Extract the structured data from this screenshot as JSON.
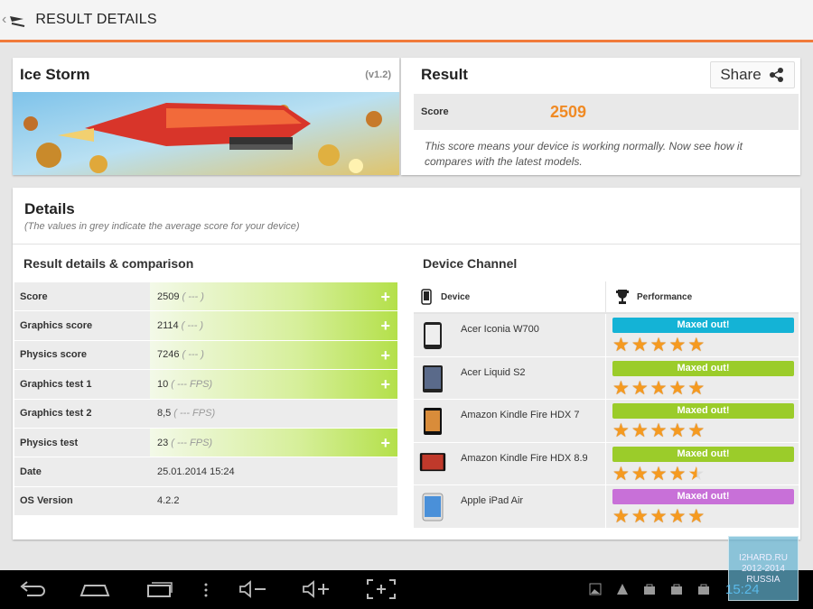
{
  "actionbar": {
    "title": "RESULT DETAILS"
  },
  "test": {
    "name": "Ice Storm",
    "version": "(v1.2)"
  },
  "result": {
    "title": "Result",
    "share_label": "Share",
    "score_label": "Score",
    "score_value": "2509",
    "note": "This score means your device is working normally. Now see how it compares with the latest models."
  },
  "details": {
    "title": "Details",
    "subtitle": "(The values in grey indicate the average score for your device)",
    "left_title": "Result details & comparison",
    "right_title": "Device Channel",
    "rows": [
      {
        "label": "Score",
        "value": "2509",
        "avg": "( --- )",
        "expandable": true
      },
      {
        "label": "Graphics score",
        "value": "2114",
        "avg": "( --- )",
        "expandable": true
      },
      {
        "label": "Physics score",
        "value": "7246",
        "avg": "( --- )",
        "expandable": true
      },
      {
        "label": "Graphics test 1",
        "value": "10",
        "avg": "( --- FPS)",
        "expandable": true
      },
      {
        "label": "Graphics test 2",
        "value": "8,5",
        "avg": "( --- FPS)",
        "expandable": false
      },
      {
        "label": "Physics test",
        "value": "23",
        "avg": "( --- FPS)",
        "expandable": true
      },
      {
        "label": "Date",
        "value": "25.01.2014 15:24",
        "avg": "",
        "expandable": false
      },
      {
        "label": "OS Version",
        "value": "4.2.2",
        "avg": "",
        "expandable": false
      }
    ],
    "device_header": "Device",
    "performance_header": "Performance",
    "devices": [
      {
        "name": "Acer Iconia W700",
        "status": "Maxed out!",
        "color": "#14b3d6",
        "stars": 5
      },
      {
        "name": "Acer Liquid S2",
        "status": "Maxed out!",
        "color": "#9bcc2a",
        "stars": 5
      },
      {
        "name": "Amazon Kindle Fire HDX 7",
        "status": "Maxed out!",
        "color": "#9bcc2a",
        "stars": 5
      },
      {
        "name": "Amazon Kindle Fire HDX 8.9",
        "status": "Maxed out!",
        "color": "#9bcc2a",
        "stars": 4.5
      },
      {
        "name": "Apple iPad Air",
        "status": "Maxed out!",
        "color": "#c870d8",
        "stars": 5
      }
    ]
  },
  "statusbar": {
    "time": "15:24"
  },
  "watermark": {
    "line1": "I2HARD.RU",
    "line2": "2012-2014",
    "line3": "RUSSIA"
  },
  "colors": {
    "accent": "#f07a3a",
    "score": "#f08a24"
  }
}
